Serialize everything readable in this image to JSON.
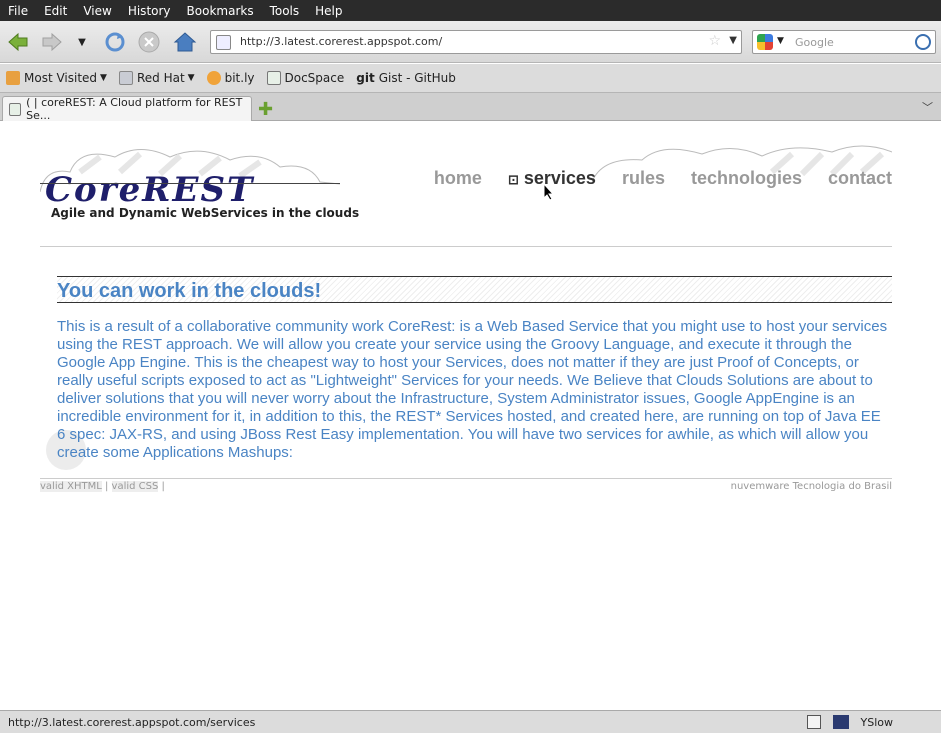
{
  "menu": [
    "File",
    "Edit",
    "View",
    "History",
    "Bookmarks",
    "Tools",
    "Help"
  ],
  "urlbar": {
    "url": "http://3.latest.corerest.appspot.com/"
  },
  "search": {
    "placeholder": "Google"
  },
  "bookmarks": [
    {
      "label": "Most Visited",
      "icon": "most-visited-icon",
      "dropdown": true
    },
    {
      "label": "Red Hat",
      "icon": "folder-icon",
      "dropdown": true
    },
    {
      "label": "bit.ly",
      "icon": "bitly-icon",
      "dropdown": false
    },
    {
      "label": "DocSpace",
      "icon": "docspace-icon",
      "dropdown": false
    },
    {
      "label": "Gist - GitHub",
      "icon": "git-icon",
      "dropdown": false,
      "prefix": "git"
    }
  ],
  "tab": {
    "title": "( | coreREST: A Cloud platform for REST Se..."
  },
  "site": {
    "logo": "CoreREST",
    "tagline": "Agile and Dynamic WebServices in the clouds",
    "nav": [
      "home",
      "services",
      "rules",
      "technologies",
      "contact"
    ],
    "active_nav": "services",
    "heading": "You can work in the clouds!",
    "body": "This is a result of a collaborative community work CoreRest: is a Web Based Service that you might use to host your services using the REST approach. We will allow you create your service using the Groovy Language, and execute it through the Google App Engine. This is the cheapest way to host your Services, does not matter if they are just Proof of Concepts, or really useful scripts exposed to act as \"Lightweight\" Services for your needs. We Believe that Clouds Solutions are about to deliver solutions that you will never worry about the Infrastructure, System Administrator issues, Google AppEngine is an incredible environment for it, in addition to this, the REST* Services hosted, and created here, are running on top of Java EE 6 spec: JAX-RS, and using JBoss Rest Easy implementation. You will have two services for awhile, as which will allow you create some Applications Mashups:",
    "footer_left": [
      "valid XHTML",
      "valid CSS"
    ],
    "footer_right": "nuvemware Tecnologia do Brasil"
  },
  "status": {
    "url": "http://3.latest.corerest.appspot.com/services",
    "yslow": "YSlow"
  },
  "colors": {
    "link": "#4a84c4",
    "logo": "#1f1f6b",
    "nav_inactive": "#999999"
  }
}
